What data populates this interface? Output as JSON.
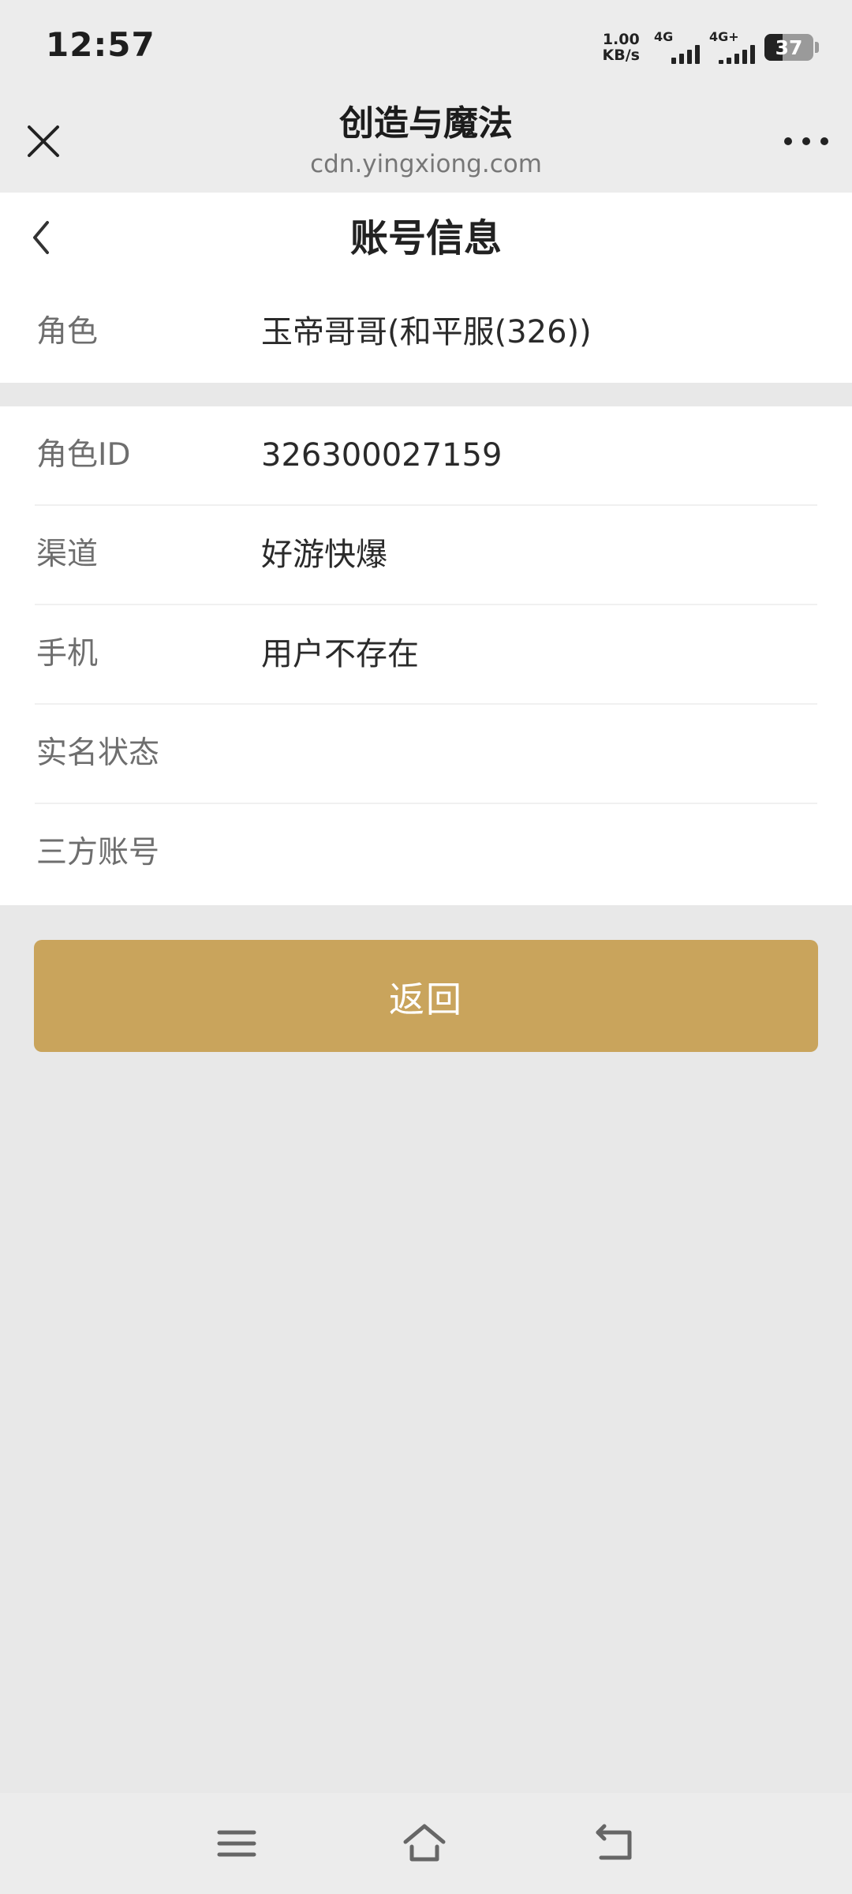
{
  "status_bar": {
    "time": "12:57",
    "net_speed_value": "1.00",
    "net_speed_unit": "KB/s",
    "signal_1_tag": "4G",
    "signal_2_tag": "4G+",
    "battery": "37"
  },
  "title_bar": {
    "title": "创造与魔法",
    "subtitle": "cdn.yingxiong.com",
    "close_icon": "close-icon",
    "more_icon": "more-icon"
  },
  "page": {
    "title": "账号信息",
    "back_icon": "chevron-left-icon"
  },
  "role": {
    "label": "角色",
    "value": "玉帝哥哥(和平服(326))"
  },
  "details": [
    {
      "label": "角色ID",
      "value": "326300027159"
    },
    {
      "label": "渠道",
      "value": "好游快爆"
    },
    {
      "label": "手机",
      "value": "用户不存在"
    },
    {
      "label": "实名状态",
      "value": ""
    },
    {
      "label": "三方账号",
      "value": ""
    }
  ],
  "actions": {
    "return_label": "返回"
  },
  "nav_bar": {
    "menu_icon": "menu-icon",
    "home_icon": "home-icon",
    "back_icon": "back-icon"
  },
  "colors": {
    "accent": "#c9a45c",
    "background": "#e8e8e8",
    "surface": "#ffffff"
  }
}
